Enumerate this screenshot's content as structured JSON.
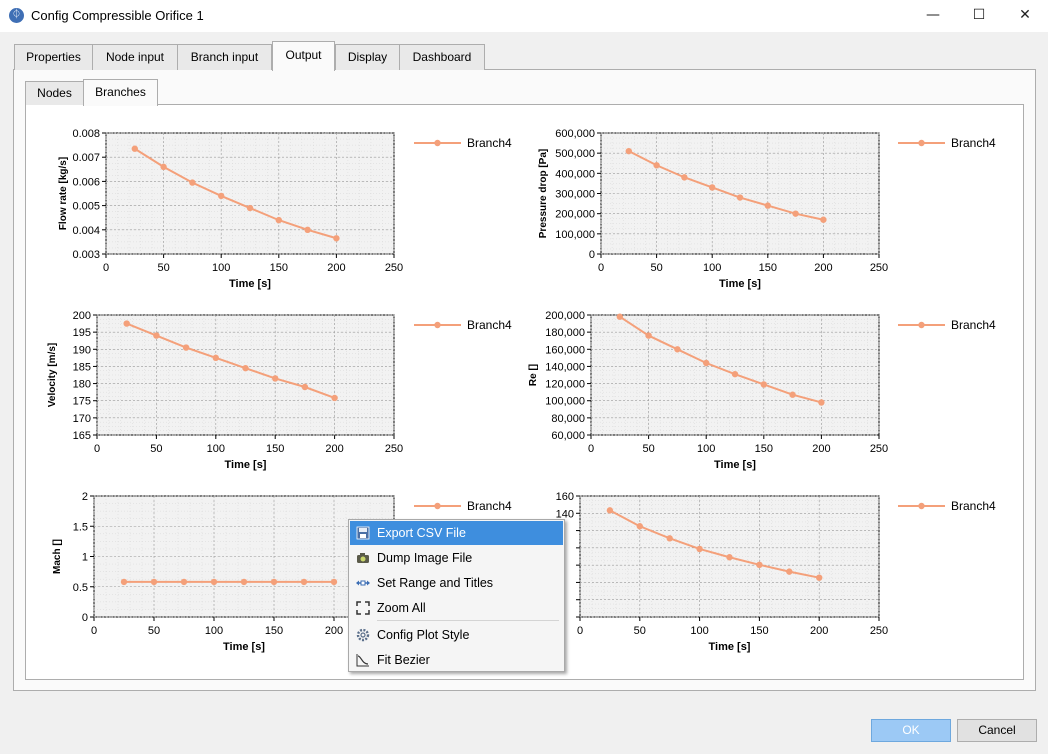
{
  "window": {
    "title": "Config Compressible Orifice 1",
    "icon": "app-orifice-icon",
    "minimize": "—",
    "maximize": "☐",
    "close": "✕"
  },
  "tabs": [
    "Properties",
    "Node input",
    "Branch input",
    "Output",
    "Display",
    "Dashboard"
  ],
  "active_tab": "Output",
  "subtabs": [
    "Nodes",
    "Branches"
  ],
  "active_subtab": "Branches",
  "series_color": "#f4a07a",
  "chart_data": [
    {
      "type": "line",
      "ylabel": "Flow rate [kg/s]",
      "xlabel": "Time  [s]",
      "xlim": [
        0,
        250
      ],
      "ylim": [
        0.003,
        0.008
      ],
      "xticks": [
        "0",
        "50",
        "100",
        "150",
        "200",
        "250"
      ],
      "yticks": [
        "0.003",
        "0.004",
        "0.005",
        "0.006",
        "0.007",
        "0.008"
      ],
      "grid": true,
      "legend": "right",
      "series": [
        {
          "name": "Branch4",
          "x": [
            25,
            50,
            75,
            100,
            125,
            150,
            175,
            200
          ],
          "y": [
            0.00735,
            0.0066,
            0.00595,
            0.0054,
            0.0049,
            0.0044,
            0.004,
            0.00365
          ]
        }
      ]
    },
    {
      "type": "line",
      "ylabel": "Pressure drop [Pa]",
      "xlabel": "Time  [s]",
      "xlim": [
        0,
        250
      ],
      "ylim": [
        0,
        600000
      ],
      "xticks": [
        "0",
        "50",
        "100",
        "150",
        "200",
        "250"
      ],
      "yticks": [
        "0",
        "100,000",
        "200,000",
        "300,000",
        "400,000",
        "500,000",
        "600,000"
      ],
      "grid": true,
      "legend": "right",
      "series": [
        {
          "name": "Branch4",
          "x": [
            25,
            50,
            75,
            100,
            125,
            150,
            175,
            200
          ],
          "y": [
            510000,
            440000,
            380000,
            330000,
            280000,
            240000,
            200000,
            170000
          ]
        }
      ]
    },
    {
      "type": "line",
      "ylabel": "Velocity [m/s]",
      "xlabel": "Time  [s]",
      "xlim": [
        0,
        250
      ],
      "ylim": [
        165,
        200
      ],
      "xticks": [
        "0",
        "50",
        "100",
        "150",
        "200",
        "250"
      ],
      "yticks": [
        "165",
        "170",
        "175",
        "180",
        "185",
        "190",
        "195",
        "200"
      ],
      "grid": true,
      "legend": "right",
      "series": [
        {
          "name": "Branch4",
          "x": [
            25,
            50,
            75,
            100,
            125,
            150,
            175,
            200
          ],
          "y": [
            197.5,
            194,
            190.5,
            187.5,
            184.5,
            181.5,
            179,
            175.8
          ]
        }
      ]
    },
    {
      "type": "line",
      "ylabel": "Re []",
      "xlabel": "Time  [s]",
      "xlim": [
        0,
        250
      ],
      "ylim": [
        60000,
        200000
      ],
      "xticks": [
        "0",
        "50",
        "100",
        "150",
        "200",
        "250"
      ],
      "yticks": [
        "60,000",
        "80,000",
        "100,000",
        "120,000",
        "140,000",
        "160,000",
        "180,000",
        "200,000"
      ],
      "grid": true,
      "legend": "right",
      "series": [
        {
          "name": "Branch4",
          "x": [
            25,
            50,
            75,
            100,
            125,
            150,
            175,
            200
          ],
          "y": [
            198000,
            176000,
            160000,
            144000,
            131000,
            119000,
            107000,
            98000
          ]
        }
      ]
    },
    {
      "type": "line",
      "ylabel": "Mach []",
      "xlabel": "Time  [s]",
      "xlim": [
        0,
        250
      ],
      "ylim": [
        0,
        2
      ],
      "xticks": [
        "0",
        "50",
        "100",
        "150",
        "200",
        "250"
      ],
      "yticks": [
        "0",
        "0.5",
        "1",
        "1.5",
        "2"
      ],
      "grid": true,
      "legend": "right",
      "series": [
        {
          "name": "Branch4",
          "x": [
            25,
            50,
            75,
            100,
            125,
            150,
            175,
            200
          ],
          "y": [
            0.58,
            0.58,
            0.58,
            0.58,
            0.58,
            0.58,
            0.58,
            0.58
          ]
        }
      ]
    },
    {
      "type": "line",
      "ylabel": "",
      "xlabel": "Time  [s]",
      "xlim": [
        0,
        250
      ],
      "ylim": [
        0,
        160
      ],
      "xticks": [
        "0",
        "50",
        "100",
        "150",
        "200",
        "250"
      ],
      "yticks": [
        "",
        "",
        "",
        "",
        "",
        "",
        "140",
        "160"
      ],
      "grid": true,
      "legend": "right",
      "series": [
        {
          "name": "Branch4",
          "x": [
            25,
            50,
            75,
            100,
            125,
            150,
            175,
            200
          ],
          "y": [
            141,
            120,
            104,
            90,
            79,
            69,
            60,
            52
          ]
        }
      ]
    }
  ],
  "context_menu": {
    "items": [
      {
        "label": "Export CSV File",
        "icon": "save-icon"
      },
      {
        "label": "Dump Image File",
        "icon": "camera-icon"
      },
      {
        "label": "Set Range and Titles",
        "icon": "range-icon"
      },
      {
        "label": "Zoom All",
        "icon": "zoom-all-icon"
      },
      {
        "label": "Config Plot Style",
        "icon": "gear-icon"
      },
      {
        "label": "Fit Bezier",
        "icon": "bezier-icon"
      }
    ],
    "highlighted": "Export CSV File"
  },
  "buttons": {
    "ok": "OK",
    "cancel": "Cancel"
  }
}
